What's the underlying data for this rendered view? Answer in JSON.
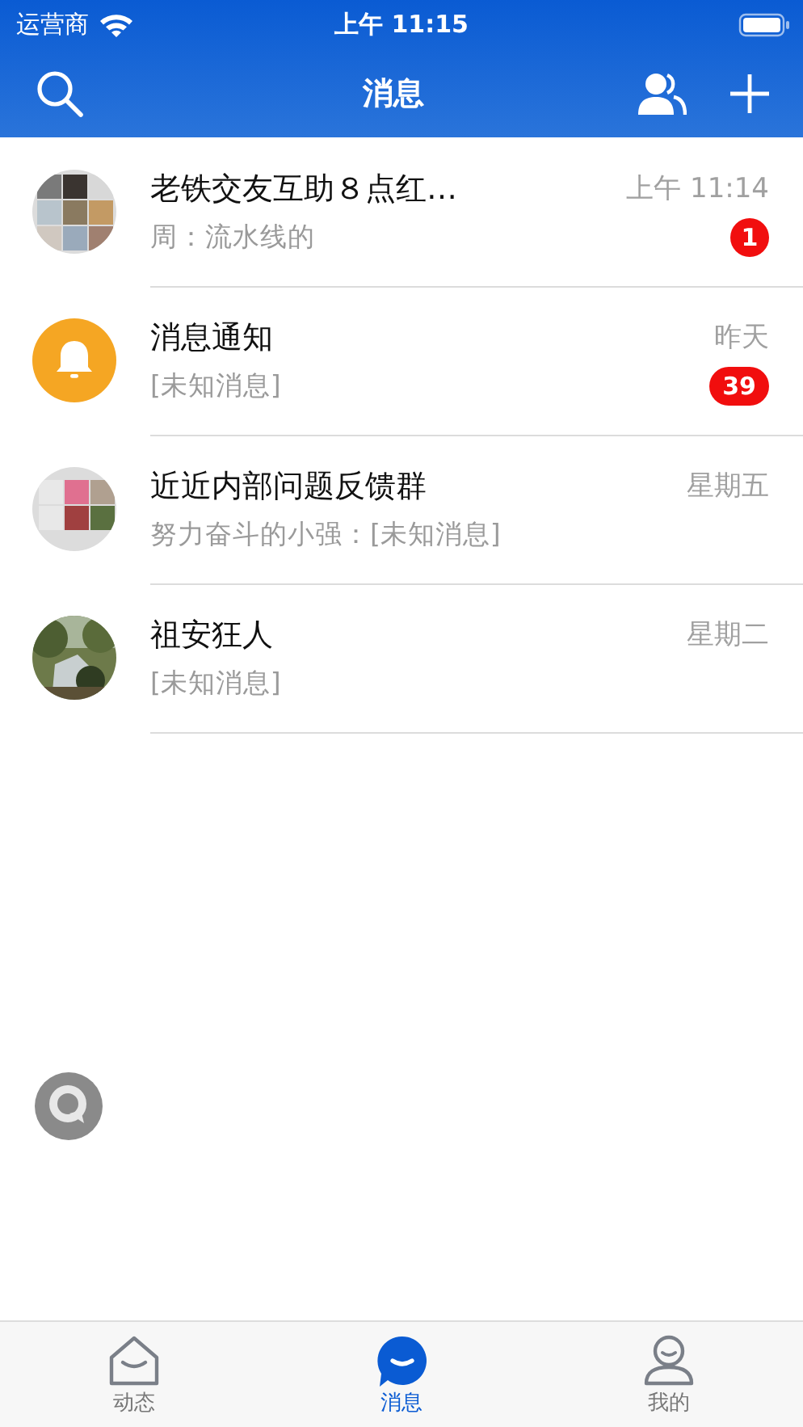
{
  "status_bar": {
    "carrier": "运营商",
    "time": "上午 11:15"
  },
  "nav": {
    "title": "消息"
  },
  "chats": [
    {
      "kind": "picture",
      "title": "老铁交友互助８点红…",
      "preview": "周：流水线的",
      "time": "上午 11:14",
      "badge": "1"
    },
    {
      "kind": "bell",
      "title": "消息通知",
      "preview": "[未知消息]",
      "time": "昨天",
      "badge": "39"
    },
    {
      "kind": "picture",
      "title": "近近内部问题反馈群",
      "preview": "努力奋斗的小强：[未知消息]",
      "time": "星期五"
    },
    {
      "kind": "picture",
      "title": "祖安狂人",
      "preview": "[未知消息]",
      "time": "星期二"
    }
  ],
  "tabs": [
    {
      "label": "动态",
      "selected": false
    },
    {
      "label": "消息",
      "selected": true
    },
    {
      "label": "我的",
      "selected": false
    }
  ]
}
